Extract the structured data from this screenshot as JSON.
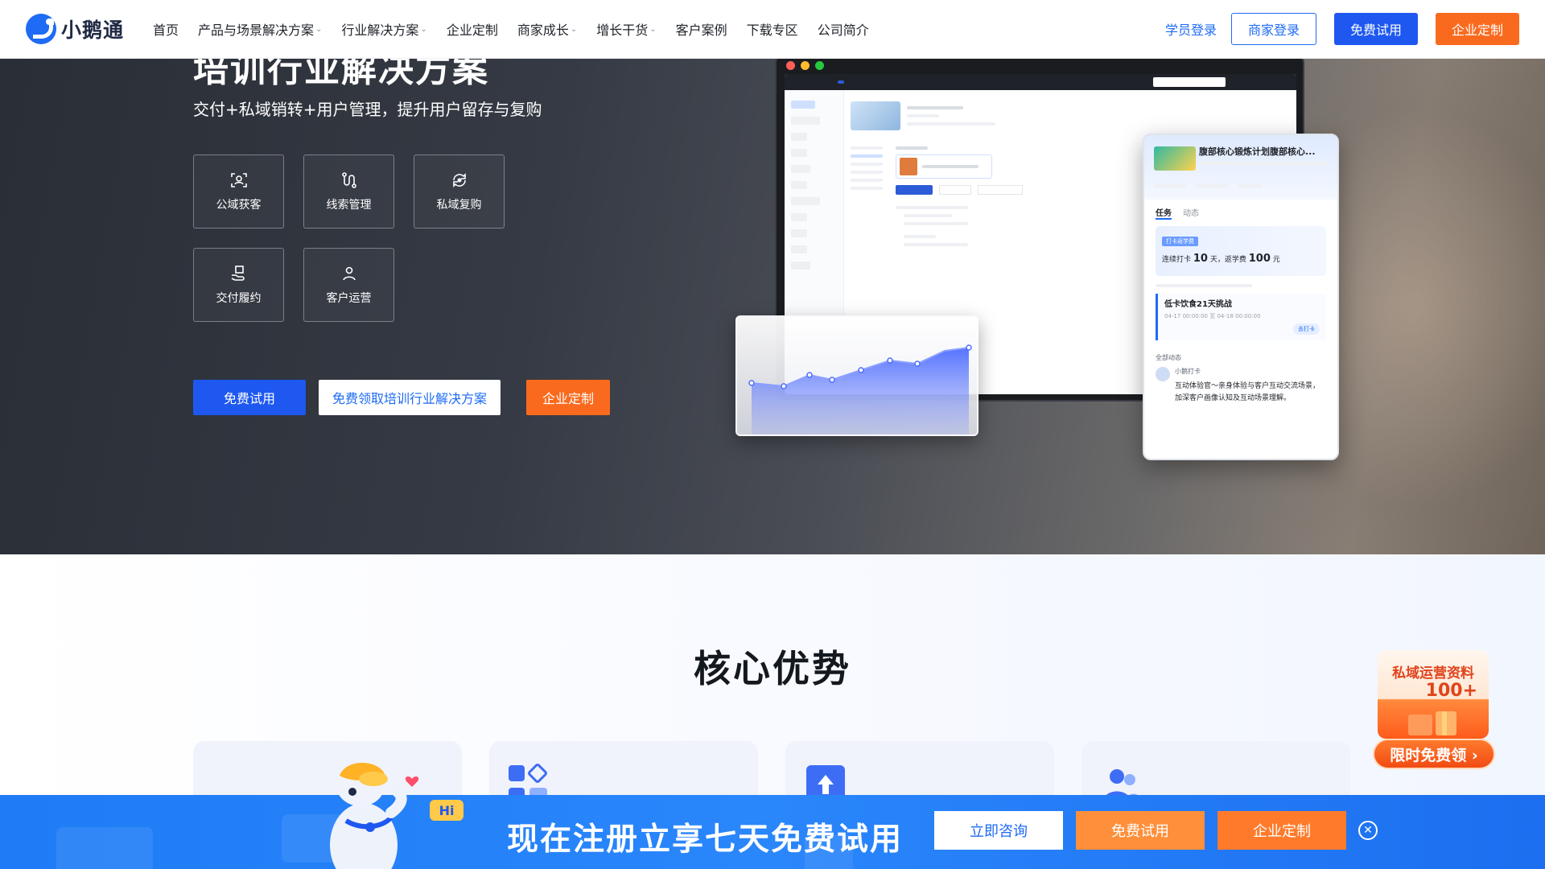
{
  "nav": {
    "logo_text": "小鹅通",
    "menu": [
      {
        "label": "首页",
        "has_dropdown": false
      },
      {
        "label": "产品与场景解决方案",
        "has_dropdown": true
      },
      {
        "label": "行业解决方案",
        "has_dropdown": true
      },
      {
        "label": "企业定制",
        "has_dropdown": false
      },
      {
        "label": "商家成长",
        "has_dropdown": true
      },
      {
        "label": "增长干货",
        "has_dropdown": true
      },
      {
        "label": "客户案例",
        "has_dropdown": false
      },
      {
        "label": "下载专区",
        "has_dropdown": false
      },
      {
        "label": "公司简介",
        "has_dropdown": false
      }
    ],
    "student_login": "学员登录",
    "merchant_login": "商家登录",
    "free_trial": "免费试用",
    "enterprise": "企业定制"
  },
  "hero": {
    "title": "培训行业解决方案",
    "subtitle": "交付+私域销转+用户管理，提升用户留存与复购",
    "features": [
      {
        "label": "公域获客",
        "icon": "scan-person-icon"
      },
      {
        "label": "线索管理",
        "icon": "route-icon"
      },
      {
        "label": "私域复购",
        "icon": "refresh-coin-icon"
      },
      {
        "label": "交付履约",
        "icon": "hand-package-icon"
      },
      {
        "label": "客户运营",
        "icon": "user-icon"
      }
    ],
    "btn_trial": "免费试用",
    "btn_solution": "免费领取培训行业解决方案",
    "btn_enterprise": "企业定制",
    "phone": {
      "title": "腹部核心锻炼计划腹部核心...",
      "tab_task": "任务",
      "tab_feed": "动态",
      "card_tag": "打卡返学费",
      "card_text": "连续打卡",
      "card_days": "10",
      "card_days_unit": "天，返学费",
      "card_money": "100",
      "card_money_unit": "元",
      "task_title": "低卡饮食21天挑战",
      "task_time": "04-17 00:00:00 至 04-18 00:00:00",
      "task_btn": "去打卡",
      "feed_title": "全部动态",
      "feed_name": "小鹅打卡",
      "feed_text": "互动体验官～亲身体验与客户互动交流场景，加深客户画像认知及互动场景理解。"
    }
  },
  "core": {
    "title": "核心优势"
  },
  "promo": {
    "line1": "私域运营资料",
    "line2": "100+",
    "btn": "限时免费领 ›"
  },
  "bottom_bar": {
    "text": "现在注册立享七天免费试用",
    "consult": "立即咨询",
    "trial": "免费试用",
    "enterprise": "企业定制",
    "mascot_badge": "Hi"
  },
  "colors": {
    "primary_blue": "#1e58f0",
    "accent_orange": "#fa6a1e",
    "hero_dark": "#2f333b"
  }
}
